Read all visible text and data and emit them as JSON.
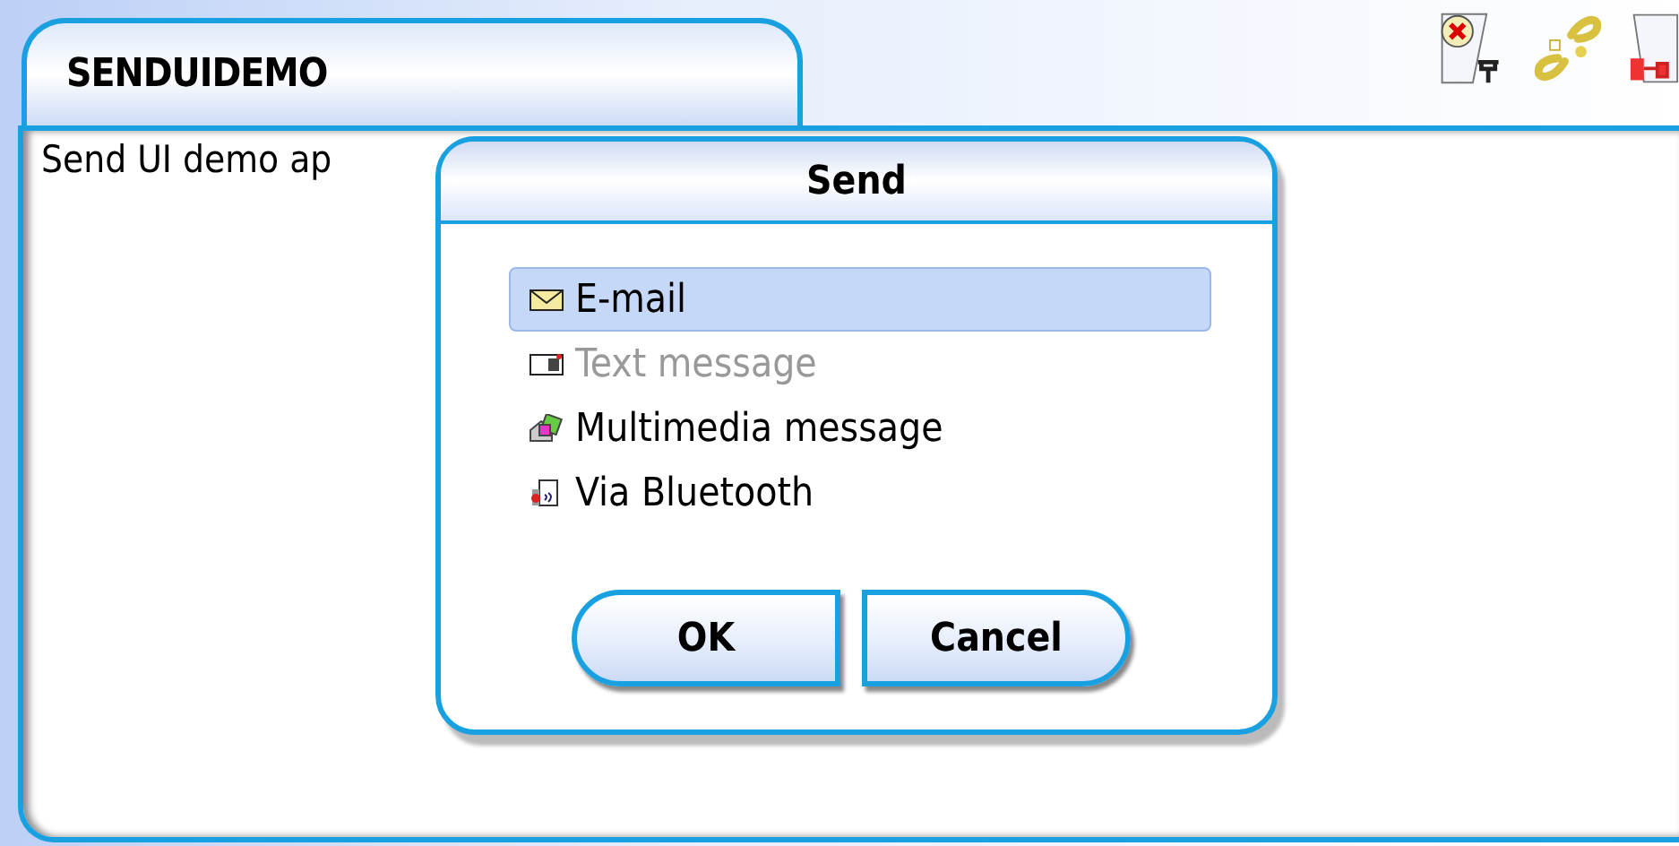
{
  "app": {
    "title": "SENDUIDEMO",
    "body_text": "Send UI demo ap"
  },
  "dialog": {
    "title": "Send",
    "items": [
      {
        "label": "E-mail",
        "kind": "email",
        "selected": true,
        "disabled": false
      },
      {
        "label": "Text message",
        "kind": "sms",
        "selected": false,
        "disabled": true
      },
      {
        "label": "Multimedia message",
        "kind": "mms",
        "selected": false,
        "disabled": false
      },
      {
        "label": "Via Bluetooth",
        "kind": "bluetooth",
        "selected": false,
        "disabled": false
      }
    ],
    "buttons": [
      "OK",
      "Cancel"
    ]
  }
}
